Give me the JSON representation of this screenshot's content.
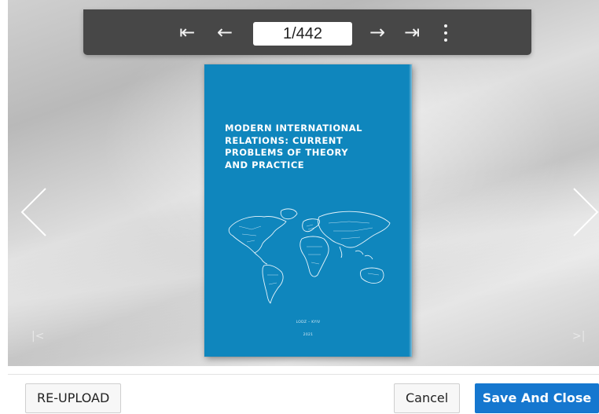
{
  "toolbar": {
    "first_glyph": "⇤",
    "prev_glyph": "←",
    "page_indicator": "1/442",
    "next_glyph": "→",
    "last_glyph": "⇥",
    "icons": [
      "first-page-icon",
      "previous-page-icon",
      "next-page-icon",
      "last-page-icon",
      "more-options-icon"
    ]
  },
  "document": {
    "title": "MODERN INTERNATIONAL\nRELATIONS: CURRENT\nPROBLEMS OF THEORY\nAND PRACTICE",
    "city": "LODZ – KYIV",
    "year": "2021",
    "cover_color": "#0f86bd"
  },
  "viewer": {
    "faint_first_glyph": "|<",
    "faint_last_glyph": ">|"
  },
  "footer": {
    "reupload_label": "RE-UPLOAD",
    "cancel_label": "Cancel",
    "save_label": "Save And Close",
    "save_color": "#1577cf"
  }
}
